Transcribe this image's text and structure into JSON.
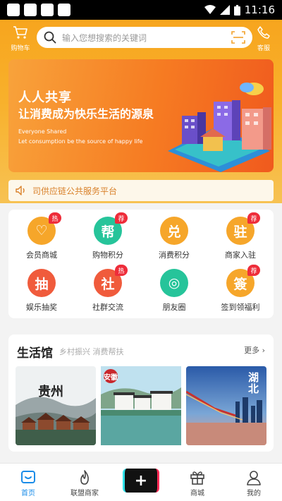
{
  "status": {
    "time": "11:16"
  },
  "header": {
    "cart_label": "购物车",
    "search_placeholder": "输入您想搜索的关键词",
    "service_label": "客服"
  },
  "banner": {
    "headline1": "人人共享",
    "headline2": "让消费成为快乐生活的源泉",
    "english1": "Everyone Shared",
    "english2": "Let consumption be the source of happy life"
  },
  "notice": {
    "text": "司供应链公共服务平台"
  },
  "grid": [
    {
      "glyph": "♡",
      "label": "会员商城",
      "badge": "热",
      "color": "#f6a62a"
    },
    {
      "glyph": "帮",
      "label": "购物积分",
      "badge": "荐",
      "color": "#26c49a"
    },
    {
      "glyph": "兑",
      "label": "消费积分",
      "badge": "",
      "color": "#f6a62a"
    },
    {
      "glyph": "驻",
      "label": "商家入驻",
      "badge": "荐",
      "color": "#f6a62a"
    },
    {
      "glyph": "抽",
      "label": "娱乐抽奖",
      "badge": "",
      "color": "#f05b3c"
    },
    {
      "glyph": "社",
      "label": "社群交流",
      "badge": "热",
      "color": "#f05b3c"
    },
    {
      "glyph": "◎",
      "label": "朋友圈",
      "badge": "",
      "color": "#26c49a"
    },
    {
      "glyph": "簽",
      "label": "签到领福利",
      "badge": "荐",
      "color": "#f6a62a"
    }
  ],
  "life": {
    "title": "生活馆",
    "subtitle": "乡村振兴 消费帮扶",
    "more": "更多",
    "pics": [
      {
        "label": "贵州"
      },
      {
        "label": "安徽"
      },
      {
        "label": "湖北"
      }
    ]
  },
  "tabs": [
    {
      "label": "首页",
      "active": true
    },
    {
      "label": "联盟商家",
      "active": false
    },
    {
      "label": "+",
      "active": false
    },
    {
      "label": "商城",
      "active": false
    },
    {
      "label": "我的",
      "active": false
    }
  ],
  "colors": {
    "accent": "#f7a51e",
    "notice_text": "#d9812a",
    "badge": "#ee2d3a",
    "tab_active": "#1a8ce8"
  }
}
